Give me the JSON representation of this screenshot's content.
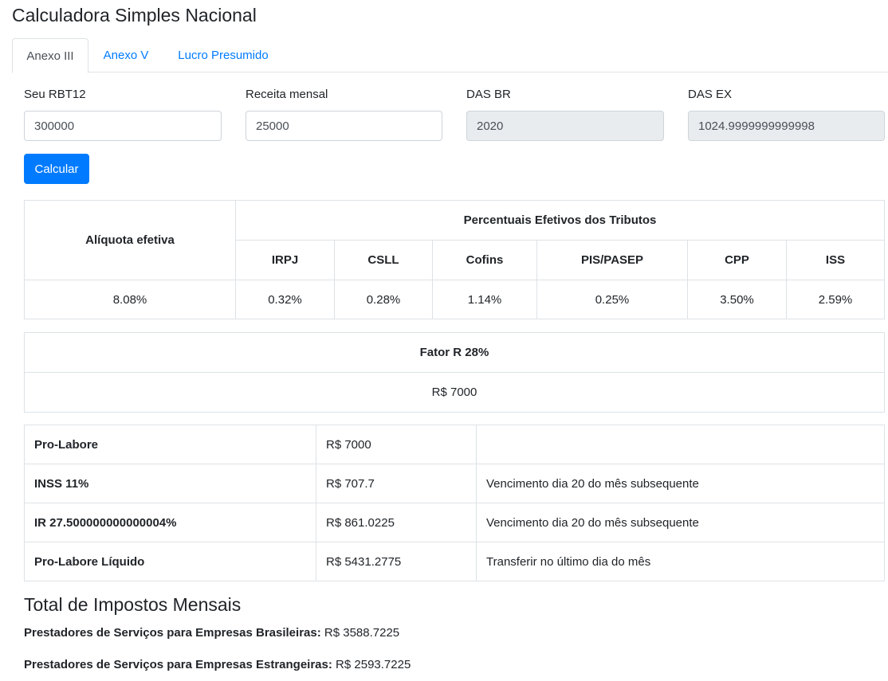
{
  "title": "Calculadora Simples Nacional",
  "tabs": [
    {
      "label": "Anexo III",
      "active": true
    },
    {
      "label": "Anexo V",
      "active": false
    },
    {
      "label": "Lucro Presumido",
      "active": false
    }
  ],
  "form": {
    "rbt12": {
      "label": "Seu RBT12",
      "value": "300000"
    },
    "receita": {
      "label": "Receita mensal",
      "value": "25000"
    },
    "das_br": {
      "label": "DAS BR",
      "value": "2020"
    },
    "das_ex": {
      "label": "DAS EX",
      "value": "1024.9999999999998"
    },
    "calc_label": "Calcular"
  },
  "tributos": {
    "aliquota_header": "Alíquota efetiva",
    "group_header": "Percentuais Efetivos dos Tributos",
    "columns": [
      "IRPJ",
      "CSLL",
      "Cofins",
      "PIS/PASEP",
      "CPP",
      "ISS"
    ],
    "aliquota_value": "8.08%",
    "values": [
      "0.32%",
      "0.28%",
      "1.14%",
      "0.25%",
      "3.50%",
      "2.59%"
    ]
  },
  "fator_r": {
    "header": "Fator R 28%",
    "value": "R$ 7000"
  },
  "prolabore": [
    {
      "label": "Pro-Labore",
      "value": "R$ 7000",
      "note": ""
    },
    {
      "label": "INSS 11%",
      "value": "R$ 707.7",
      "note": "Vencimento dia 20 do mês subsequente"
    },
    {
      "label": "IR 27.500000000000004%",
      "value": "R$ 861.0225",
      "note": "Vencimento dia 20 do mês subsequente"
    },
    {
      "label": "Pro-Labore Líquido",
      "value": "R$ 5431.2775",
      "note": "Transferir no último dia do mês"
    }
  ],
  "totals": {
    "title": "Total de Impostos Mensais",
    "br_label": "Prestadores de Serviços para Empresas Brasileiras:",
    "br_value": "R$ 3588.7225",
    "ex_label": "Prestadores de Serviços para Empresas Estrangeiras:",
    "ex_value": "R$ 2593.7225"
  },
  "colors": {
    "primary": "#007bff",
    "border": "#dee2e6",
    "readonly_bg": "#e9ecef"
  }
}
